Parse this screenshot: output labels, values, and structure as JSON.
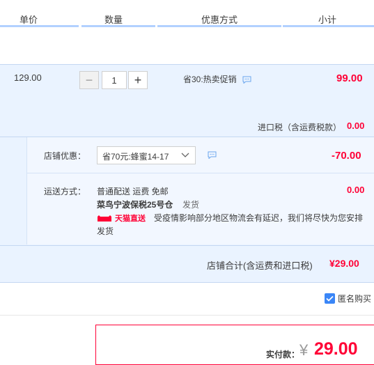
{
  "header": {
    "col_price": "单价",
    "col_qty": "数量",
    "col_promo": "优惠方式",
    "col_subtotal": "小计"
  },
  "item": {
    "unit_price": "129.00",
    "quantity": "1",
    "decrease_symbol": "−",
    "increase_symbol": "+",
    "promo": "省30:热卖促销",
    "subtotal": "99.00",
    "import_tax_label": "进口税（含运费税款）",
    "import_tax_value": "0.00"
  },
  "shop": {
    "discount_label": "店铺优惠：",
    "discount_selected": "省70元:蜂蜜14-17",
    "discount_value": "-70.00",
    "shipping_label": "运送方式：",
    "shipping_method": "普通配送 运费 免邮",
    "warehouse": "菜鸟宁波保税25号仓",
    "ship_status": "发货",
    "brand_tag": "天猫直送",
    "notice": "受疫情影响部分地区物流会有延迟，我们将尽快为您安排",
    "notice_end": "发货",
    "shipping_value": "0.00",
    "total_label": "店铺合计(含运费和进口税)",
    "total_value": "¥29.00"
  },
  "anonymous_label": "匿名购买",
  "payment": {
    "label": "实付款：",
    "currency": "¥",
    "amount": "29.00"
  },
  "colors": {
    "accent_red": "#ff0036",
    "header_line": "#b2d1ff",
    "row_bg": "#eaf3ff",
    "checkbox_blue": "#3a86f7"
  }
}
